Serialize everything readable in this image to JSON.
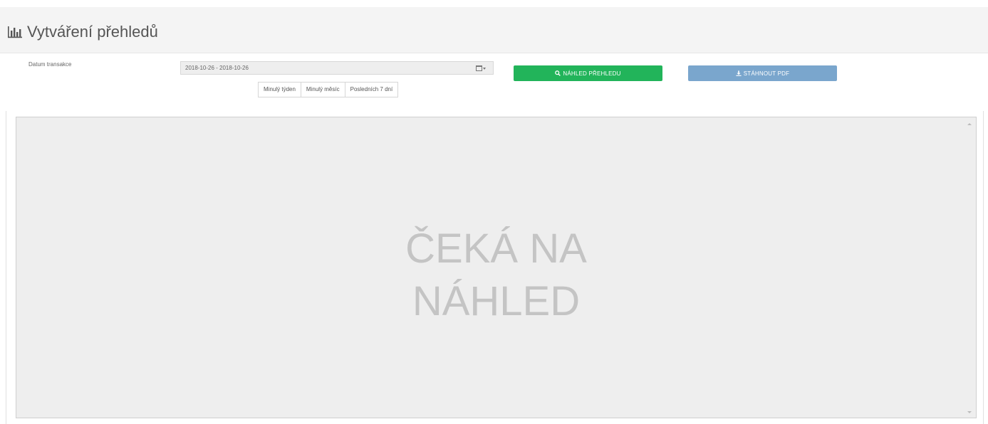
{
  "header": {
    "title": "Vytváření přehledů",
    "icon": "bar-chart-icon"
  },
  "filters": {
    "date_label": "Datum transakce",
    "date_value": "2018-10-26 - 2018-10-26",
    "calendar_icon": "calendar-icon",
    "presets": [
      "Minulý týden",
      "Minulý měsíc",
      "Posledních 7 dní"
    ]
  },
  "actions": {
    "preview_label": "NÁHLED PŘEHLEDU",
    "preview_icon": "search-icon",
    "preview_color": "#22b45a",
    "pdf_label": "STÁHNOUT PDF",
    "pdf_icon": "download-icon",
    "pdf_color": "#7aa6cd"
  },
  "preview": {
    "line1": "ČEKÁ NA",
    "line2": "NÁHLED"
  }
}
